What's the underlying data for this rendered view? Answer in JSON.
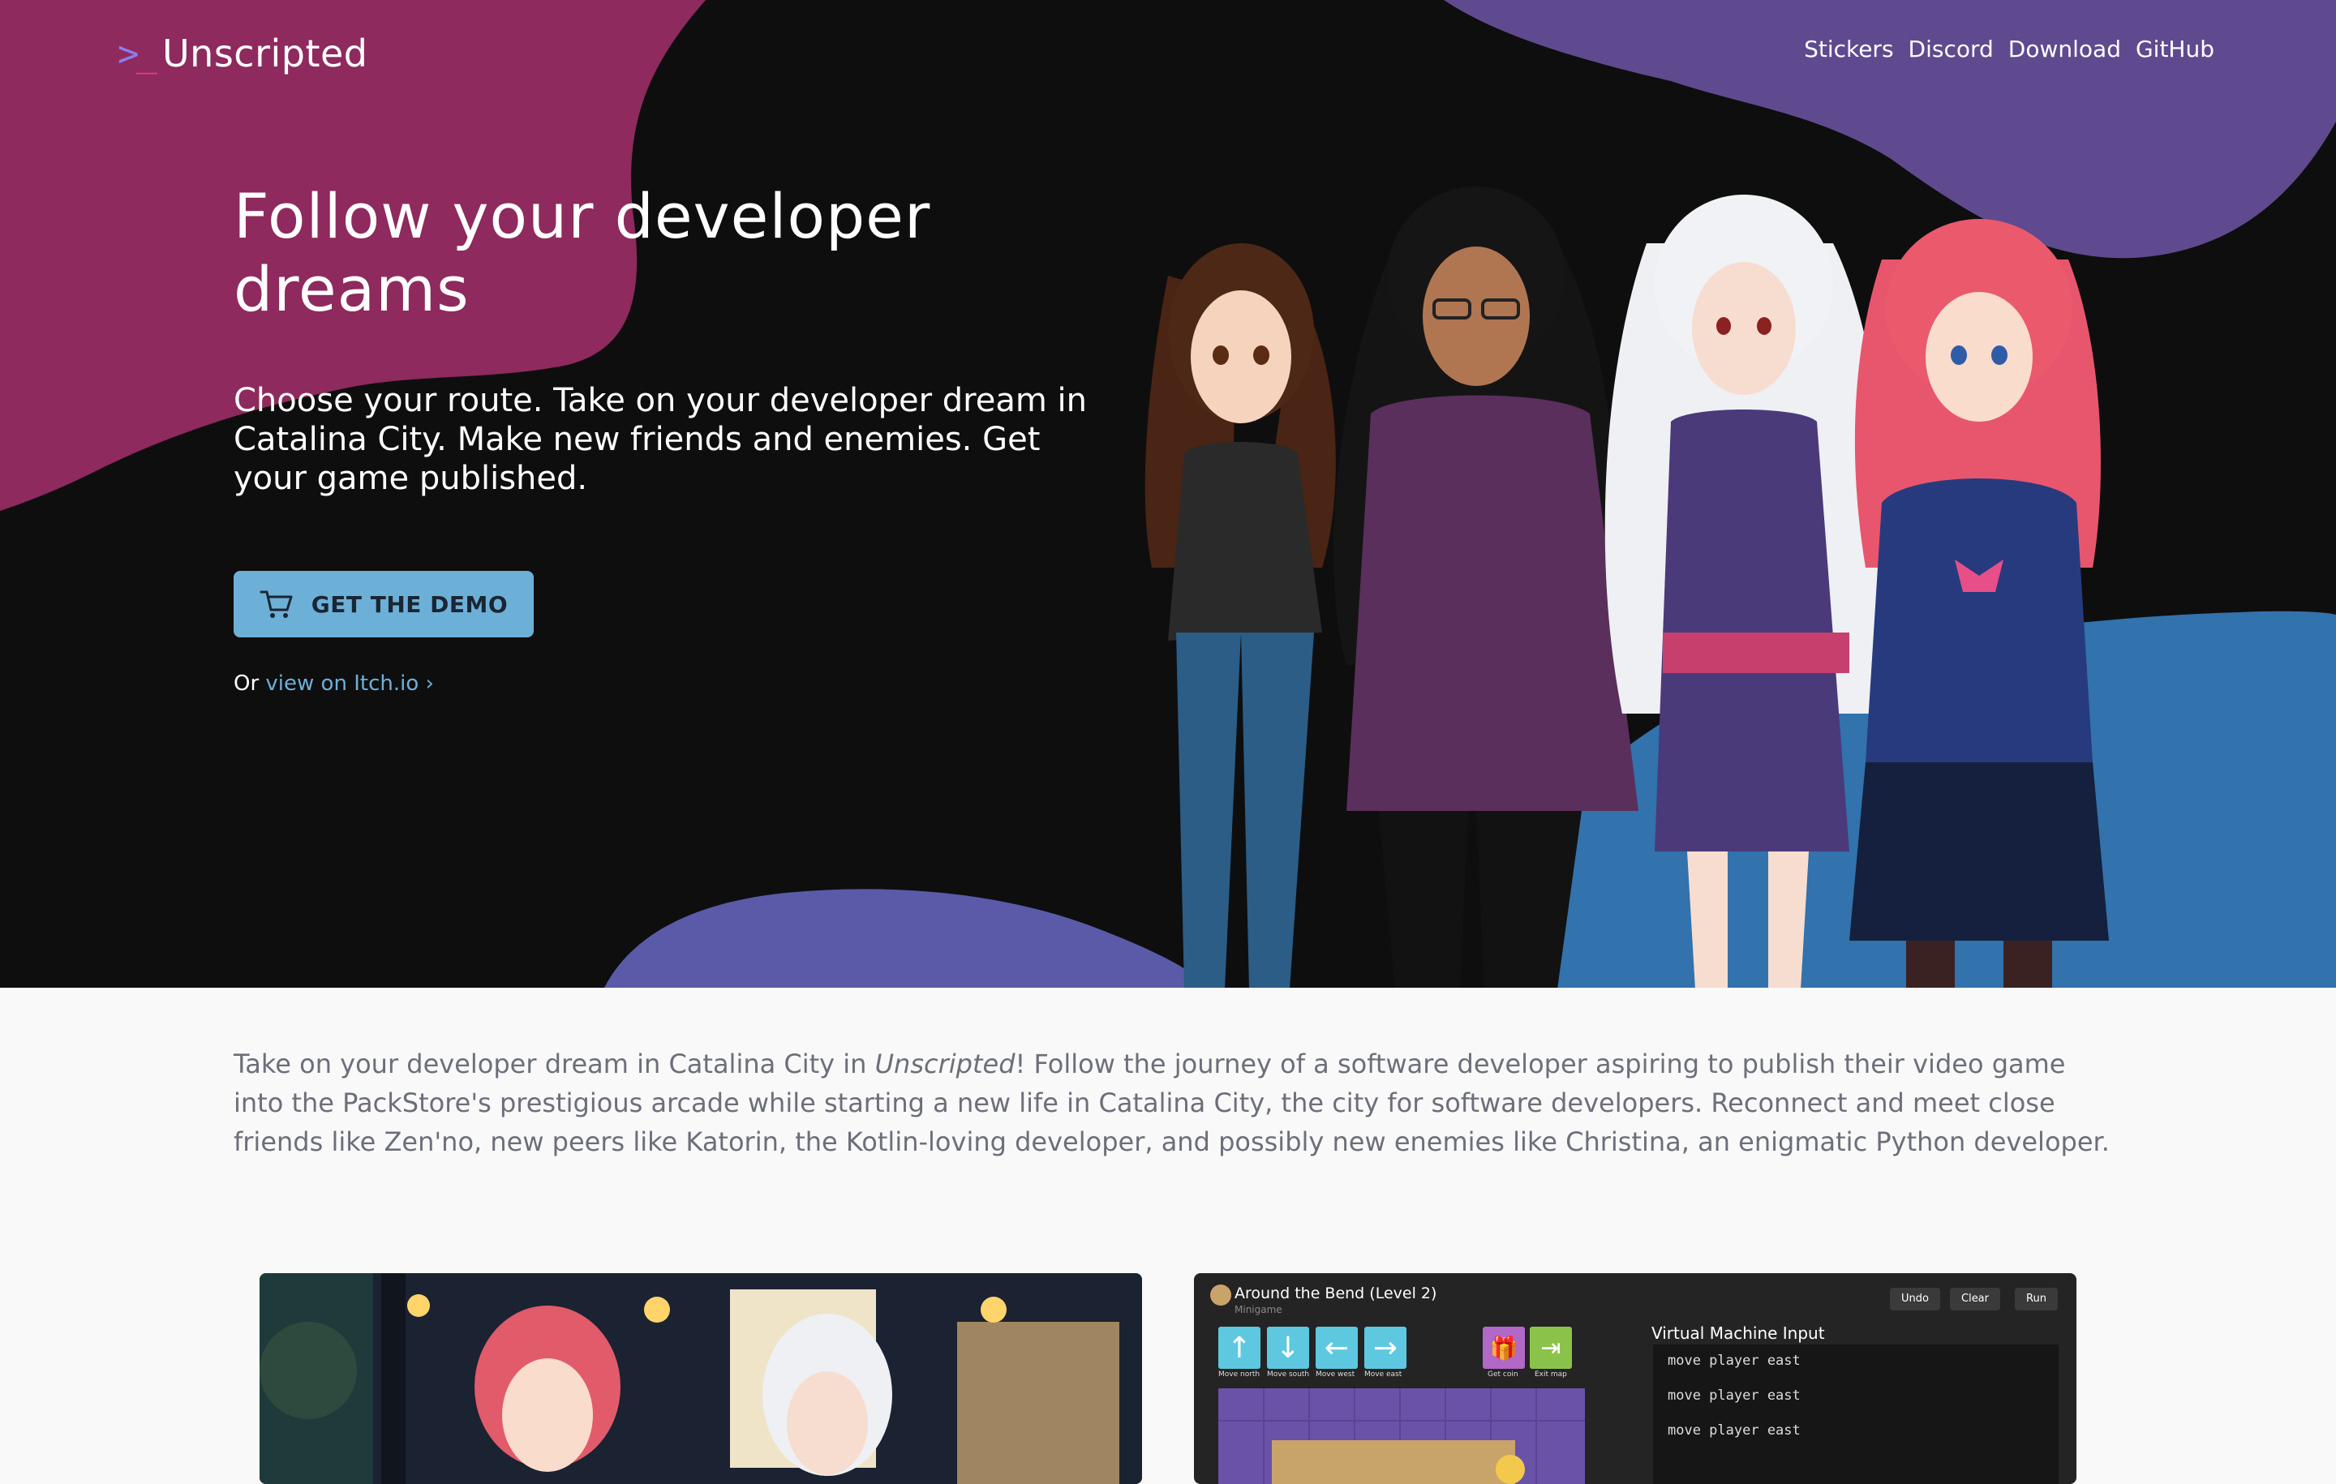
{
  "nav": {
    "logo_mark_chevron": ">",
    "logo_mark_underscore": "_",
    "logo_text": "Unscripted",
    "links": [
      "Stickers",
      "Discord",
      "Download",
      "GitHub"
    ]
  },
  "hero": {
    "title": "Follow your developer dreams",
    "subtitle": "Choose your route. Take on your developer dream in Catalina City. Make new friends and enemies. Get your game published.",
    "cta_label": "GET THE DEMO",
    "cta_icon": "cart-icon",
    "alt_prefix": "Or ",
    "alt_link": "view on Itch.io ›"
  },
  "about": {
    "before_italic": "Take on your developer dream in Catalina City in ",
    "italic": "Unscripted",
    "after_italic": "! Follow the journey of a software developer aspiring to publish their video game into the PackStore's prestigious arcade while starting a new life in Catalina City, the city for software developers. Reconnect and meet close friends like Zen'no, new peers like Katorin, the Kotlin-loving developer, and possibly new enemies like Christina, an enigmatic Python developer."
  },
  "minigame": {
    "title": "Around the Bend (Level 2)",
    "subtitle": "Minigame",
    "buttons": [
      "Undo",
      "Clear",
      "Run"
    ],
    "moves": [
      {
        "label": "Move north",
        "icon": "arrow-up-icon",
        "glyph": "↑"
      },
      {
        "label": "Move south",
        "icon": "arrow-down-icon",
        "glyph": "↓"
      },
      {
        "label": "Move west",
        "icon": "arrow-left-icon",
        "glyph": "←"
      },
      {
        "label": "Move east",
        "icon": "arrow-right-icon",
        "glyph": "→"
      }
    ],
    "actions": [
      {
        "label": "Get coin",
        "icon": "gift-icon",
        "glyph": "🎁"
      },
      {
        "label": "Exit map",
        "icon": "exit-icon",
        "glyph": "⇥"
      }
    ],
    "vm_label": "Virtual Machine Input",
    "vm_lines": [
      "move player east",
      "move player east",
      "move player east"
    ]
  },
  "colors": {
    "hero_bg": "#0e0e0f",
    "blob_magenta": "#8e2a5d",
    "blob_purple": "#5f4a8f",
    "blob_blue": "#3272ad",
    "blob_indigo": "#5a5aa8",
    "accent_button": "#6db0d7",
    "body_bg": "#f9f9f9",
    "body_text": "#6c6f7a",
    "minigame_tile_blue": "#5ec8e0",
    "minigame_tile_pink": "#b168c6",
    "minigame_tile_green": "#8bc34a",
    "minigame_board": "#6a52a8"
  }
}
